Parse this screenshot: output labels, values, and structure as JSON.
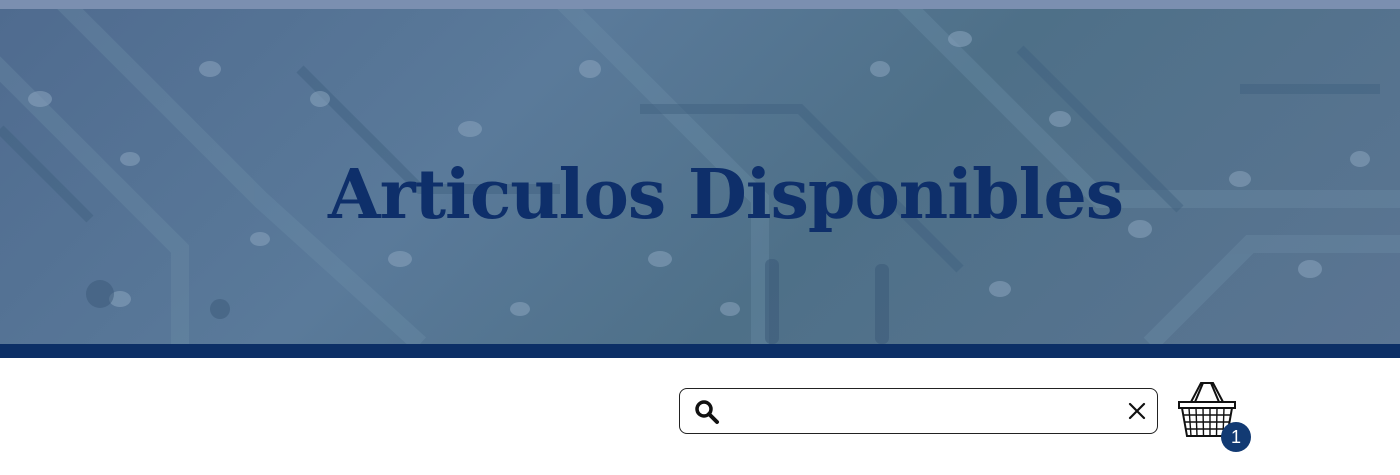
{
  "hero": {
    "title": "Articulos Disponibles"
  },
  "search": {
    "value": "",
    "placeholder": ""
  },
  "cart": {
    "count": "1"
  },
  "colors": {
    "accent": "#0c2f66",
    "hero_overlay": "#5a7a9a",
    "badge": "#123a73"
  },
  "icons": {
    "search": "search-icon",
    "clear": "close-icon",
    "cart": "basket-icon"
  }
}
